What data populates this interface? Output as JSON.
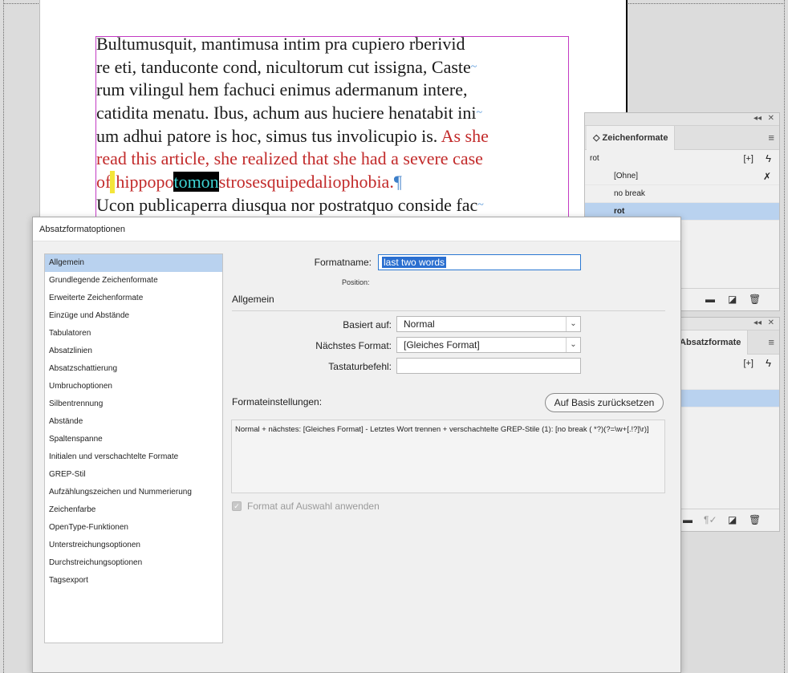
{
  "document": {
    "lines": [
      {
        "a": "Bultumusquit, mantimusa intim pra cupiero rberivid",
        "b": "",
        "c": ""
      },
      {
        "a": "re eti, tanduconte cond, nicultorum cut issigna, Caste",
        "b": "~",
        "c": ""
      },
      {
        "a": "rum vilingul hem fachuci enimus adermanum intere,",
        "b": "",
        "c": ""
      },
      {
        "a": "catidita menatu. Ibus, achum aus huciere henatabit ini",
        "b": "~",
        "c": ""
      },
      {
        "a": "um adhui patore is hoc, simus tus involicupio is. ",
        "b": "",
        "c": "As she"
      }
    ],
    "red_line_6": "read this article, she realized that she had a severe case",
    "line_7_before_caret": "of",
    "line_7_red_a": "hippopo",
    "line_7_selected": "tomon",
    "line_7_red_b": "strosesquipedaliophobia.",
    "pilcrow": "¶",
    "line_8": "Ucon publicaperra diusqua nor postratquo conside fac",
    "line_8_tilde": "~"
  },
  "char_styles_panel": {
    "collapse_icon": "◂◂",
    "close_icon": "✕",
    "tab_label": "Zeichenformate",
    "tab_prefix": "◇",
    "menu_icon": "≡",
    "current_style": "rot",
    "new_group_icon": "[+]",
    "lightning_icon": "ϟ",
    "items": [
      {
        "label": "[Ohne]"
      },
      {
        "label": "no break"
      },
      {
        "label": "rot"
      }
    ],
    "clear_icon": "✗",
    "footer_icons": [
      "▬",
      "◪",
      "🗑"
    ]
  },
  "para_styles_panel": {
    "collapse_icon": "◂◂",
    "close_icon": "✕",
    "tab_label": "Absatzformate",
    "menu_icon": "≡",
    "new_group_icon": "[+]",
    "lightning_icon": "ϟ",
    "footer_icons": [
      "▬",
      "¶✓",
      "◪",
      "🗑"
    ]
  },
  "dialog": {
    "title": "Absatzformatoptionen",
    "categories": [
      "Allgemein",
      "Grundlegende Zeichenformate",
      "Erweiterte Zeichenformate",
      "Einzüge und Abstände",
      "Tabulatoren",
      "Absatzlinien",
      "Absatzschattierung",
      "Umbruchoptionen",
      "Silbentrennung",
      "Abstände",
      "Spaltenspanne",
      "Initialen und verschachtelte Formate",
      "GREP-Stil",
      "Aufzählungszeichen und Nummerierung",
      "Zeichenfarbe",
      "OpenType-Funktionen",
      "Unterstreichungsoptionen",
      "Durchstreichungsoptionen",
      "Tagsexport"
    ],
    "selected_category": "Allgemein",
    "formatname_label": "Formatname:",
    "formatname_value": "last two words",
    "position_label": "Position:",
    "section_general": "Allgemein",
    "based_on_label": "Basiert auf:",
    "based_on_value": "Normal",
    "next_style_label": "Nächstes Format:",
    "next_style_value": "[Gleiches Format]",
    "shortcut_label": "Tastaturbefehl:",
    "shortcut_value": "",
    "settings_label": "Formateinstellungen:",
    "reset_button": "Auf Basis zurücksetzen",
    "settings_text": "Normal + nächstes: [Gleiches Format] - Letztes Wort trennen + verschachtelte GREP-Stile (1): [no break ( *?)(?=\\w+[.!?]\\r)]",
    "apply_checkbox_label": "Format auf Auswahl anwenden",
    "apply_checked": true,
    "chevron": "⌄"
  }
}
